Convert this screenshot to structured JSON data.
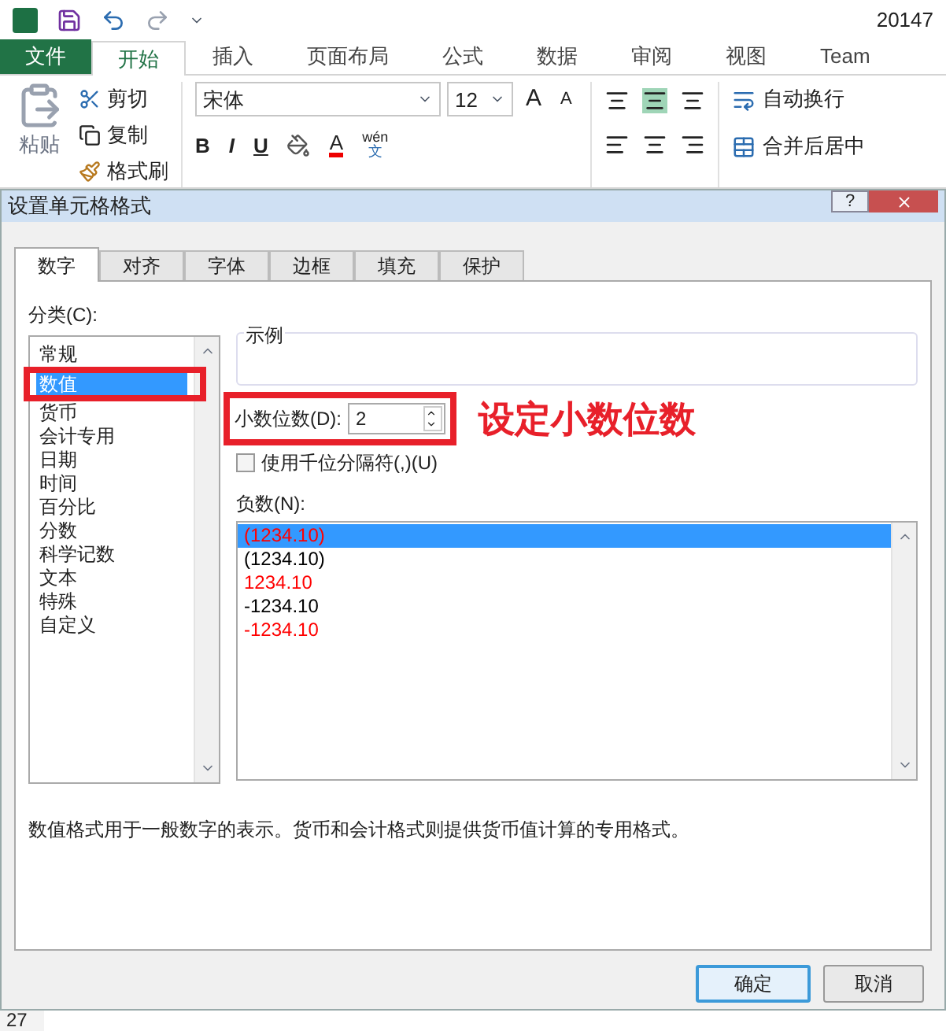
{
  "title_bar": {
    "title": "20147"
  },
  "ribbon_tabs": [
    {
      "label": "文件",
      "kind": "file"
    },
    {
      "label": "开始",
      "kind": "tab",
      "selected": true
    },
    {
      "label": "插入",
      "kind": "tab",
      "selected": false
    },
    {
      "label": "页面布局",
      "kind": "tab",
      "selected": false
    },
    {
      "label": "公式",
      "kind": "tab",
      "selected": false
    },
    {
      "label": "数据",
      "kind": "tab",
      "selected": false
    },
    {
      "label": "审阅",
      "kind": "tab",
      "selected": false
    },
    {
      "label": "视图",
      "kind": "tab",
      "selected": false
    },
    {
      "label": "Team",
      "kind": "tab",
      "selected": false
    }
  ],
  "ribbon": {
    "paste": "粘贴",
    "cut": "剪切",
    "copy": "复制",
    "format_painter": "格式刷",
    "font_name": "宋体",
    "font_size": "12",
    "grow_font": "A",
    "shrink_font": "A",
    "font_color": "A",
    "bold": "B",
    "italic": "I",
    "underline": "U",
    "phonetic_top": "wén",
    "phonetic_bottom": "文",
    "wrap_text": "自动换行",
    "merge_center": "合并后居中"
  },
  "dialog": {
    "title": "设置单元格格式",
    "help": "?",
    "tabs": [
      {
        "label": "数字",
        "selected": true
      },
      {
        "label": "对齐",
        "selected": false
      },
      {
        "label": "字体",
        "selected": false
      },
      {
        "label": "边框",
        "selected": false
      },
      {
        "label": "填充",
        "selected": false
      },
      {
        "label": "保护",
        "selected": false
      }
    ],
    "category_label": "分类(C):",
    "categories": [
      {
        "label": "常规",
        "selected": false
      },
      {
        "label": "数值",
        "selected": true
      },
      {
        "label": "货币",
        "selected": false
      },
      {
        "label": "会计专用",
        "selected": false
      },
      {
        "label": "日期",
        "selected": false
      },
      {
        "label": "时间",
        "selected": false
      },
      {
        "label": "百分比",
        "selected": false
      },
      {
        "label": "分数",
        "selected": false
      },
      {
        "label": "科学记数",
        "selected": false
      },
      {
        "label": "文本",
        "selected": false
      },
      {
        "label": "特殊",
        "selected": false
      },
      {
        "label": "自定义",
        "selected": false
      }
    ],
    "sample_label": "示例",
    "decimal_label": "小数位数(D):",
    "decimal_value": "2",
    "thousands": {
      "label": "使用千位分隔符(,)(U)",
      "checked": false
    },
    "negative_label": "负数(N):",
    "negative_numbers": [
      {
        "text": "(1234.10)",
        "color": "#ff0000",
        "selected": true
      },
      {
        "text": "(1234.10)",
        "color": "#000000",
        "selected": false
      },
      {
        "text": "1234.10",
        "color": "#ff0000",
        "selected": false
      },
      {
        "text": "-1234.10",
        "color": "#000000",
        "selected": false
      },
      {
        "text": "-1234.10",
        "color": "#ff0000",
        "selected": false
      }
    ],
    "description": "数值格式用于一般数字的表示。货币和会计格式则提供货币值计算的专用格式。",
    "buttons": [
      {
        "label": "确定",
        "default": true
      },
      {
        "label": "取消",
        "default": false
      }
    ]
  },
  "annotation": {
    "text": "设定小数位数"
  },
  "row_header": "27"
}
